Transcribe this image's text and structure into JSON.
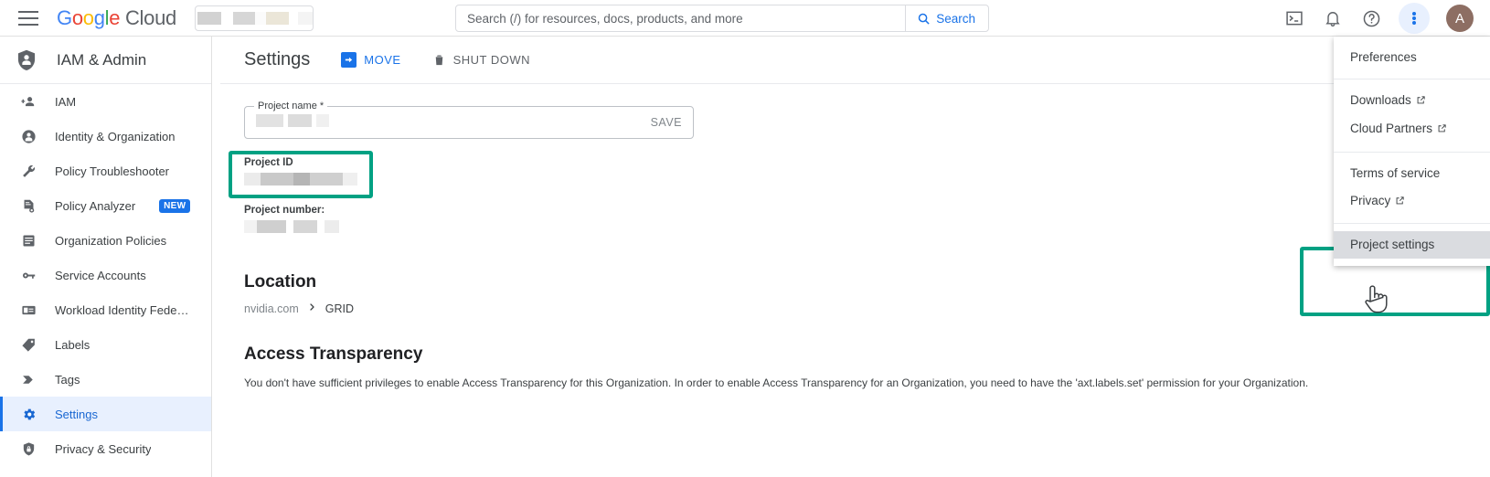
{
  "topbar": {
    "menu_icon": "hamburger-icon",
    "logo": {
      "google": "Google",
      "cloud": "Cloud"
    },
    "project_picker": "",
    "search": {
      "placeholder": "Search (/) for resources, docs, products, and more",
      "value": "",
      "button_label": "Search"
    },
    "icons": {
      "cloud_shell": "terminal-icon",
      "notifications": "bell-icon",
      "help": "help-circle-icon",
      "more": "three-dots-vertical-icon"
    },
    "avatar_initial": "A"
  },
  "sidebar": {
    "title": "IAM & Admin",
    "items": [
      {
        "label": "IAM",
        "icon": "person-add-icon",
        "active": false,
        "badge": ""
      },
      {
        "label": "Identity & Organization",
        "icon": "account-circle-icon",
        "active": false,
        "badge": ""
      },
      {
        "label": "Policy Troubleshooter",
        "icon": "wrench-icon",
        "active": false,
        "badge": ""
      },
      {
        "label": "Policy Analyzer",
        "icon": "document-analyze-icon",
        "active": false,
        "badge": "NEW"
      },
      {
        "label": "Organization Policies",
        "icon": "list-icon",
        "active": false,
        "badge": ""
      },
      {
        "label": "Service Accounts",
        "icon": "key-card-icon",
        "active": false,
        "badge": ""
      },
      {
        "label": "Workload Identity Federat…",
        "icon": "id-card-icon",
        "active": false,
        "badge": ""
      },
      {
        "label": "Labels",
        "icon": "tag-icon",
        "active": false,
        "badge": ""
      },
      {
        "label": "Tags",
        "icon": "tags-icon",
        "active": false,
        "badge": ""
      },
      {
        "label": "Settings",
        "icon": "gear-icon",
        "active": true,
        "badge": ""
      },
      {
        "label": "Privacy & Security",
        "icon": "shield-lock-icon",
        "active": false,
        "badge": ""
      }
    ]
  },
  "page": {
    "title": "Settings",
    "actions": [
      {
        "label": "MOVE",
        "icon": "move-arrow-icon",
        "style": "primary"
      },
      {
        "label": "SHUT DOWN",
        "icon": "trash-icon",
        "style": "secondary"
      }
    ],
    "project_name_field": {
      "label": "Project name *",
      "value": "",
      "save_label": "SAVE"
    },
    "project_id": {
      "label": "Project ID",
      "value": ""
    },
    "project_number": {
      "label": "Project number:",
      "value": ""
    },
    "location": {
      "heading": "Location",
      "breadcrumb_org": "nvidia.com",
      "breadcrumb_separator": "›",
      "breadcrumb_current": "GRID"
    },
    "access_transparency": {
      "heading": "Access Transparency",
      "body": "You don't have sufficient privileges to enable Access Transparency for this Organization. In order to enable Access Transparency for an Organization, you need to have the 'axt.labels.set' permission for your Organization."
    }
  },
  "menu": {
    "groups": [
      {
        "items": [
          {
            "label": "Preferences",
            "external": false,
            "highlighted": false
          }
        ]
      },
      {
        "items": [
          {
            "label": "Downloads",
            "external": true,
            "highlighted": false
          },
          {
            "label": "Cloud Partners",
            "external": true,
            "highlighted": false
          }
        ]
      },
      {
        "items": [
          {
            "label": "Terms of service",
            "external": false,
            "highlighted": false
          },
          {
            "label": "Privacy",
            "external": true,
            "highlighted": false
          }
        ]
      },
      {
        "items": [
          {
            "label": "Project settings",
            "external": false,
            "highlighted": true
          }
        ]
      }
    ]
  },
  "annotations": {
    "highlight_color": "#00a183",
    "boxes": [
      {
        "name": "project-id-highlight"
      },
      {
        "name": "project-settings-highlight"
      }
    ]
  }
}
